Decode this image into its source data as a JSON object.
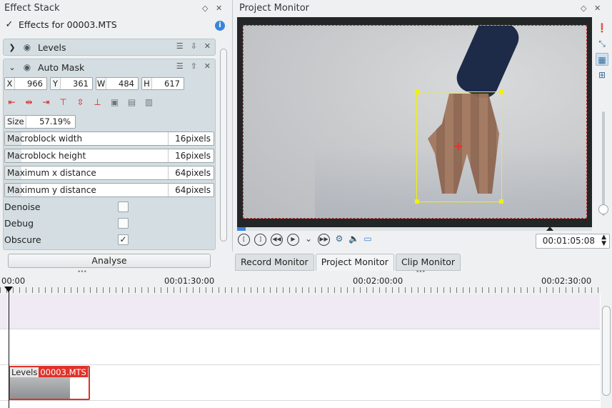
{
  "effect_stack": {
    "title": "Effect Stack",
    "effects_for": "Effects for 00003.MTS",
    "effects_enabled": true,
    "effects": [
      {
        "name": "Levels",
        "expanded": false
      },
      {
        "name": "Auto Mask",
        "expanded": true
      }
    ],
    "geometry": [
      {
        "label": "X",
        "value": "966"
      },
      {
        "label": "Y",
        "value": "361"
      },
      {
        "label": "W",
        "value": "484"
      },
      {
        "label": "H",
        "value": "617"
      }
    ],
    "size": {
      "label": "Size",
      "value": "57.19%"
    },
    "params": [
      {
        "name": "Macroblock width",
        "value": "16pixels"
      },
      {
        "name": "Macroblock height",
        "value": "16pixels"
      },
      {
        "name": "Maximum x distance",
        "value": "64pixels"
      },
      {
        "name": "Maximum y distance",
        "value": "64pixels"
      }
    ],
    "checks": [
      {
        "name": "Denoise",
        "checked": false
      },
      {
        "name": "Debug",
        "checked": false
      },
      {
        "name": "Obscure",
        "checked": true
      }
    ],
    "analyse_label": "Analyse"
  },
  "monitor": {
    "title": "Project Monitor",
    "timecode": "00:01:05:08"
  },
  "tabs": [
    {
      "label": "Record Monitor",
      "active": false
    },
    {
      "label": "Project Monitor",
      "active": true
    },
    {
      "label": "Clip Monitor",
      "active": false
    }
  ],
  "timeline": {
    "labels": [
      "00:00",
      "00:01:30:00",
      "00:02:00:00",
      "00:02:30:00"
    ],
    "clip": {
      "effect": "Levels",
      "name": "00003.MTS"
    }
  },
  "colors": {
    "accent": "#3a85d8",
    "clip_red": "#e0322a",
    "selection_yellow": "#f2f200"
  }
}
